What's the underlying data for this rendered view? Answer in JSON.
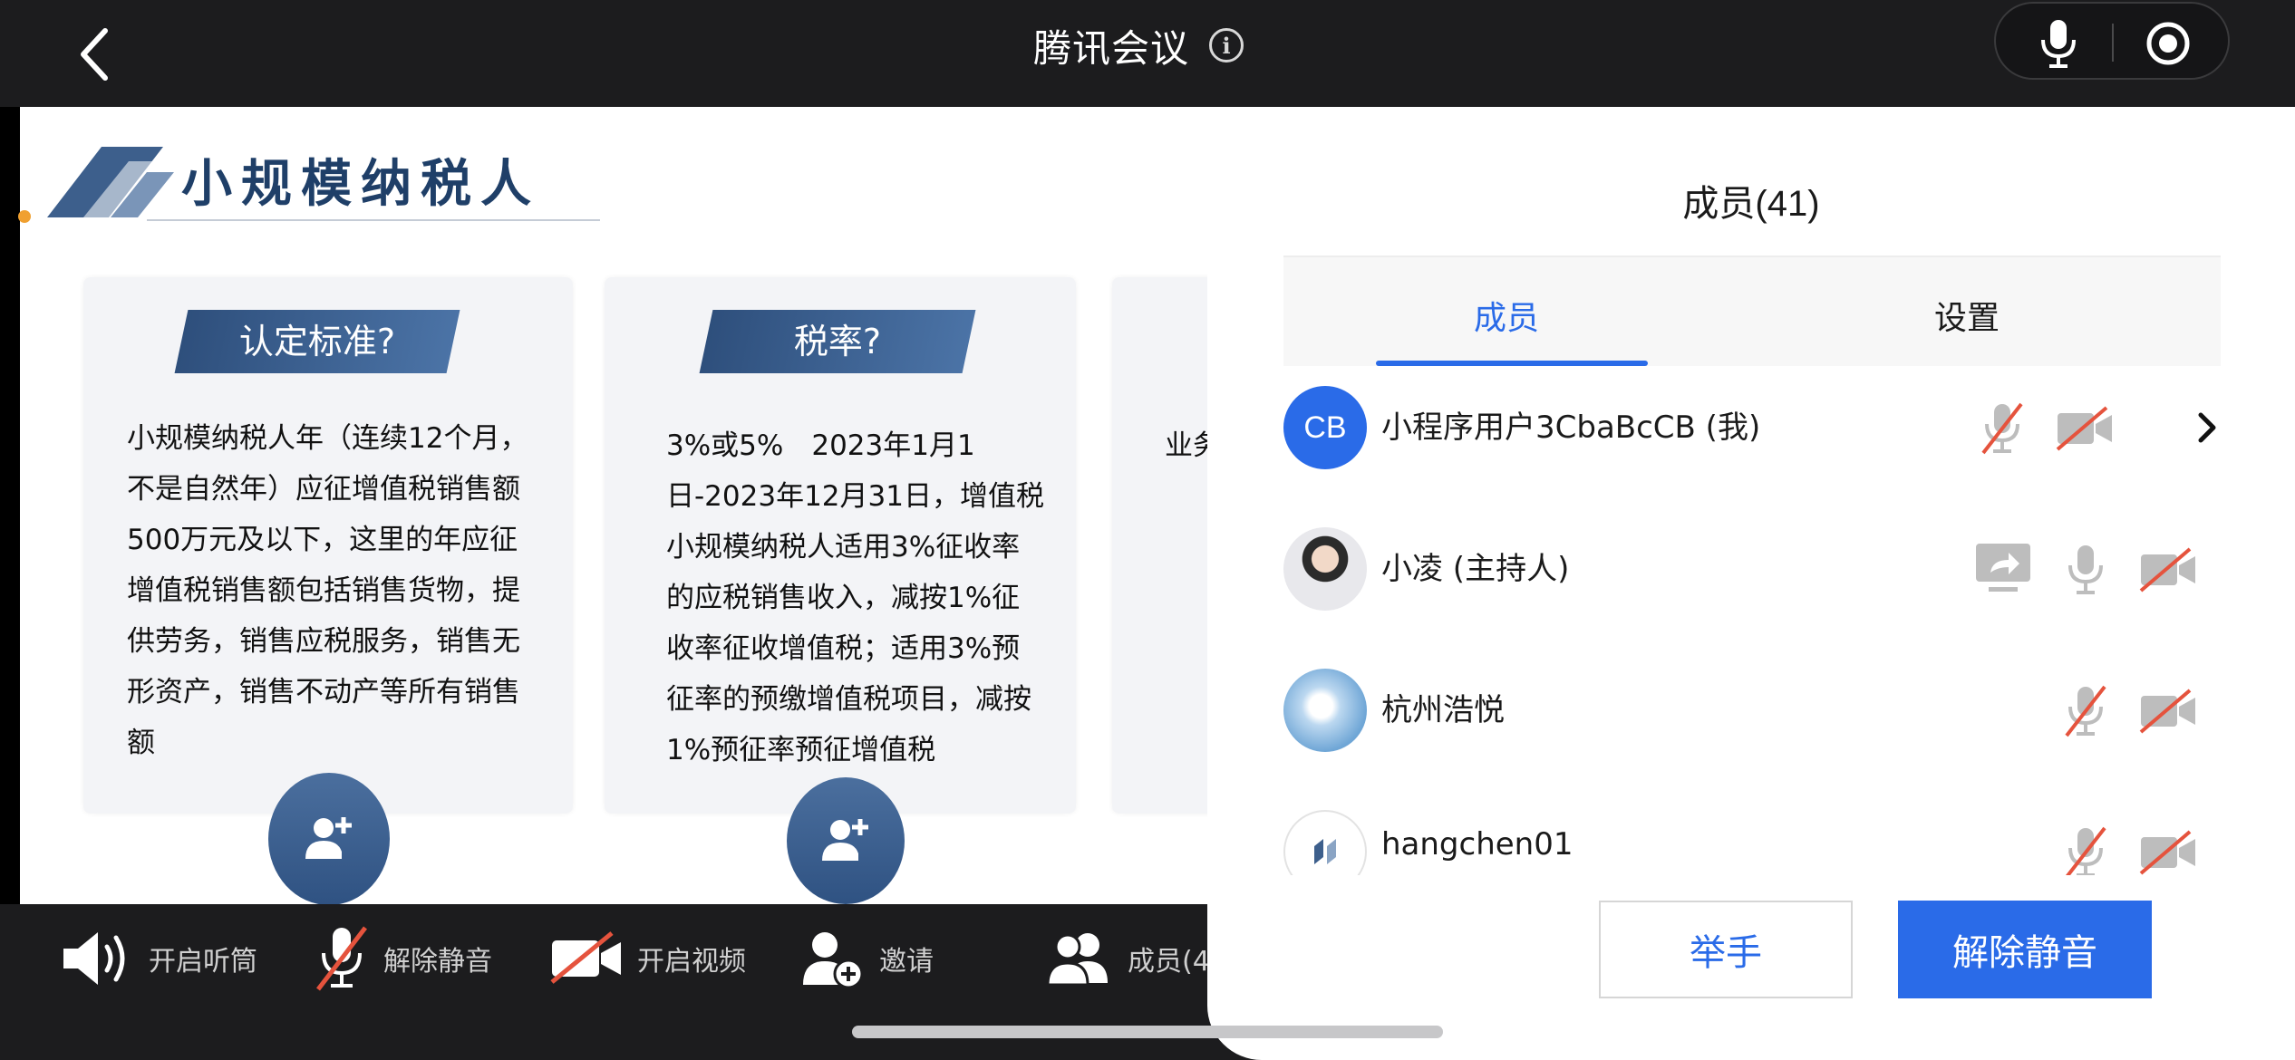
{
  "header": {
    "title": "腾讯会议"
  },
  "slide": {
    "title": "小规模纳税人",
    "cards": [
      {
        "heading": "认定标准?",
        "body": "小规模纳税人年（连续12个月，不是自然年）应征增值税销售额500万元及以下，这里的年应征增值税销售额包括销售货物，提供劳务，销售应税服务，销售无形资产，销售不动产等所有销售额"
      },
      {
        "heading": "税率?",
        "body": "3%或5%　2023年1月1日-2023年12月31日，增值税小规模纳税人适用3%征收率的应税销售收入，减按1%征收率征收增值税；适用3%预征率的预缴增值税项目，减按1%预征率预征增值税"
      },
      {
        "heading": "",
        "body": "业务（季规定"
      }
    ]
  },
  "toolbar": {
    "speaker_label": "开启听筒",
    "mute_label": "解除静音",
    "video_label": "开启视频",
    "invite_label": "邀请",
    "members_label": "成员(4"
  },
  "panel": {
    "title": "成员(41)",
    "tabs": [
      {
        "label": "成员",
        "active": true
      },
      {
        "label": "设置",
        "active": false
      }
    ],
    "members": [
      {
        "avatar_text": "CB",
        "name": "小程序用户3CbaBcCB (我)",
        "mic": "muted",
        "camera": "off",
        "sharing": false
      },
      {
        "avatar_text": "",
        "name": "小凌 (主持人)",
        "mic": "on",
        "camera": "off",
        "sharing": true
      },
      {
        "avatar_text": "",
        "name": "杭州浩悦",
        "mic": "muted",
        "camera": "off",
        "sharing": false
      },
      {
        "avatar_text": "",
        "name": "hangchen01",
        "mic": "muted",
        "camera": "off",
        "sharing": false
      }
    ],
    "raise_hand_label": "举手",
    "unmute_label": "解除静音"
  },
  "colors": {
    "accent": "#2a6be8",
    "muted_slash": "#e5533d",
    "slide_navy": "#1f3f68"
  }
}
